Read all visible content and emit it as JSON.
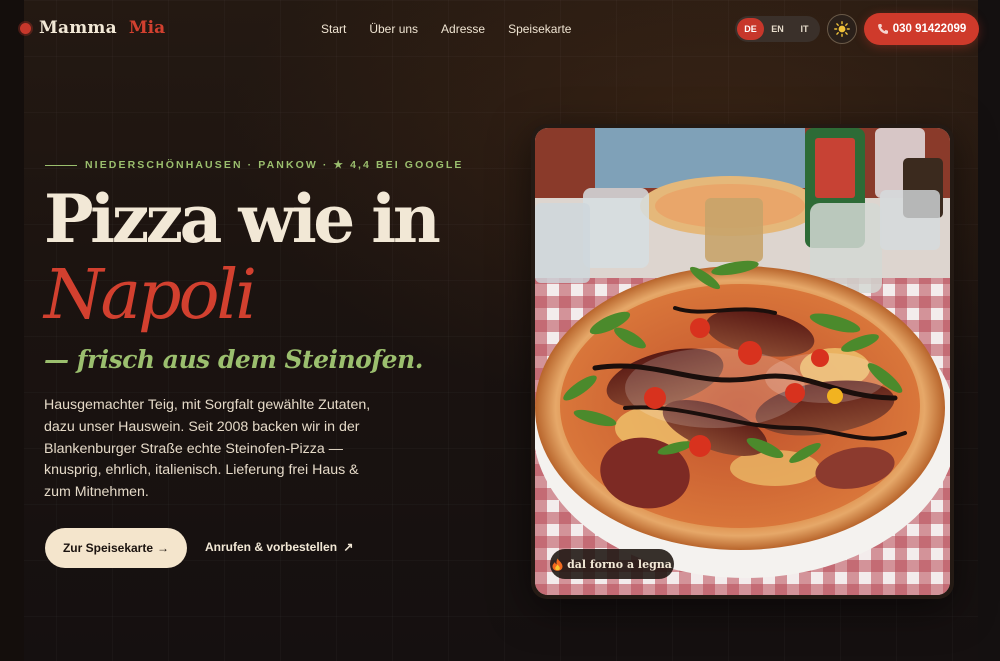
{
  "brand": {
    "word1": "Mamma",
    "word2": "Mia"
  },
  "nav": {
    "items": [
      "Start",
      "Über uns",
      "Adresse",
      "Speisekarte"
    ]
  },
  "lang": {
    "options": [
      "DE",
      "EN",
      "IT"
    ],
    "active": "DE"
  },
  "theme": {
    "icon": "sun-icon"
  },
  "phone": {
    "icon": "phone-icon",
    "number": "030 91422099"
  },
  "hero": {
    "eyebrow": "NIEDERSCHÖNHAUSEN · PANKOW · ★ 4,4 BEI GOOGLE",
    "headline_line1": "Pizza wie in",
    "headline_line2": "Napoli",
    "headline_line3": "— frisch aus dem Steinofen.",
    "lead": "Hausgemachter Teig, mit Sorgfalt gewählte Zutaten, dazu unser Hauswein. Seit 2008 backen wir in der Blankenburger Straße echte Steinofen-Pizza — knusprig, ehrlich, italienisch. Lieferung frei Haus & zum Mitnehmen.",
    "cta_primary": "Zur Speisekarte",
    "cta_primary_arrow": "→",
    "cta_secondary": "Anrufen & vorbestellen",
    "cta_secondary_arrow": "↗"
  },
  "photo": {
    "badge": "dal forno a legna",
    "badge_icon": "fire-icon"
  },
  "colors": {
    "accent_red": "#cf3a2b",
    "accent_green": "#9bbf6e",
    "cream": "#f2e8d6",
    "background": "#1a1210"
  }
}
